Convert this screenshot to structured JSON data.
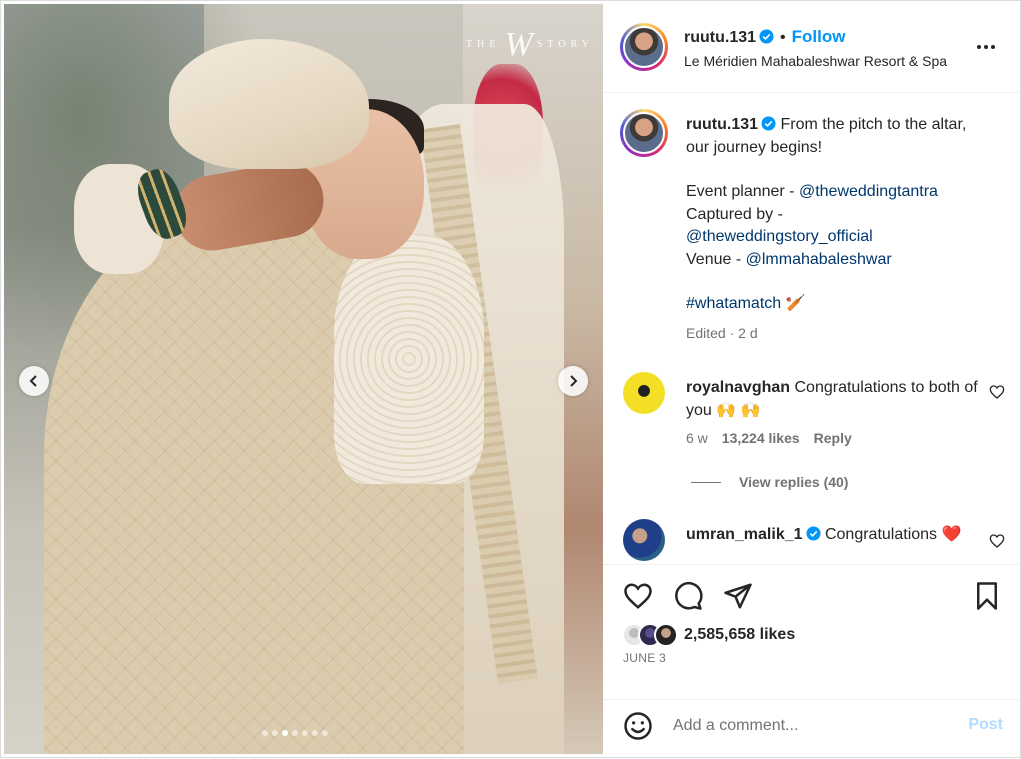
{
  "media": {
    "watermark_left": "THE",
    "watermark_mark": "W",
    "watermark_right": "STORY",
    "carousel_total": 7,
    "carousel_active_index": 2
  },
  "header": {
    "username": "ruutu.131",
    "separator": "•",
    "follow_label": "Follow",
    "location": "Le Méridien Mahabaleshwar Resort & Spa"
  },
  "caption": {
    "username": "ruutu.131",
    "text": "From the pitch to the altar, our journey begins!",
    "planner_label": "Event planner - ",
    "planner_handle": "@theweddingtantra",
    "captured_label": "Captured by -",
    "captured_handle": "@theweddingstory_official",
    "venue_label": "Venue - ",
    "venue_handle": "@lmmahabaleshwar",
    "hashtag": "#whatamatch",
    "hashtag_emoji": "🏏",
    "edited": "Edited · 2 d"
  },
  "comments": [
    {
      "username": "royalnavghan",
      "text": "Congratulations to both of you 🙌 🙌",
      "time": "6 w",
      "likes": "13,224 likes",
      "reply_label": "Reply",
      "view_replies": "View replies (40)"
    },
    {
      "username": "umran_malik_1",
      "text": "Congratulations",
      "emoji": "❤️"
    }
  ],
  "actions": {
    "likes": "2,585,658 likes",
    "date": "JUNE 3"
  },
  "add_comment": {
    "placeholder": "Add a comment...",
    "post_label": "Post"
  },
  "colors": {
    "accent": "#0095f6",
    "link": "#00376b",
    "muted": "#737373",
    "post_disabled": "#b3dbff"
  }
}
